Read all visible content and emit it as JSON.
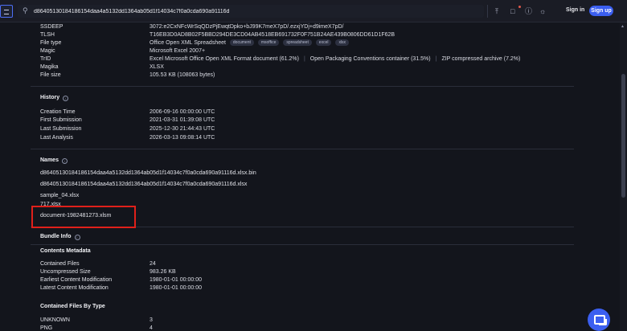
{
  "search": {
    "value": "d86405130184186154daa4a5132dd1364ab05d1f14034c7f0a0cda690a91116d"
  },
  "header": {
    "signin_label": "Sign in",
    "signup_label": "Sign up"
  },
  "basic_properties": [
    {
      "label": "SSDEEP",
      "value": "3072:e2CxNFcWrSqQDzPjEwqtDpko+bJ99K7meX7pD/.ezxjYDj+d9imeX7pD/"
    },
    {
      "label": "TLSH",
      "value": "T16EB3D0AD8B02F5BBD294DE3CD04AB4518EB691732F0F751B24AE439B0806DD61D1F62B"
    },
    {
      "label": "File type",
      "value": "Office Open XML Spreadsheet",
      "tags": [
        "document",
        "msoffice",
        "spreadsheet",
        "excel",
        "xlsx"
      ]
    },
    {
      "label": "Magic",
      "value": "Microsoft Excel 2007+"
    },
    {
      "label": "TrID",
      "parts": [
        "Excel Microsoft Office Open XML Format document (61.2%)",
        "Open Packaging Conventions container (31.5%)",
        "ZIP compressed archive (7.2%)"
      ]
    },
    {
      "label": "Magika",
      "value": "XLSX"
    },
    {
      "label": "File size",
      "value": "105.53 KB (108063 bytes)"
    }
  ],
  "history": {
    "title": "History",
    "rows": [
      {
        "label": "Creation Time",
        "value": "2006-09-16 00:00:00 UTC"
      },
      {
        "label": "First Submission",
        "value": "2021-03-31 01:39:08 UTC"
      },
      {
        "label": "Last Submission",
        "value": "2025-12-30 21:44:43 UTC"
      },
      {
        "label": "Last Analysis",
        "value": "2026-03-13 09:08:14 UTC"
      }
    ]
  },
  "names": {
    "title": "Names",
    "items": [
      "d86405130184186154daa4a5132dd1364ab05d1f14034c7f0a0cda690a91116d.xlsx.bin",
      "d86405130184186154daa4a5132dd1364ab05d1f14034c7f0a0cda690a91116d.xlsx",
      "sample_04.xlsx",
      "717.xlsx",
      "document-1982481273.xlsm"
    ]
  },
  "bundle": {
    "title": "Bundle Info",
    "contents_metadata_title": "Contents Metadata",
    "metadata": [
      {
        "label": "Contained Files",
        "value": "24"
      },
      {
        "label": "Uncompressed Size",
        "value": "983.26 KB"
      },
      {
        "label": "Earliest Content Modification",
        "value": "1980-01-01 00:00:00"
      },
      {
        "label": "Latest Content Modification",
        "value": "1980-01-01 00:00:00"
      }
    ],
    "by_type_title": "Contained Files By Type",
    "by_type": [
      {
        "label": "UNKNOWN",
        "value": "3"
      },
      {
        "label": "PNG",
        "value": "4"
      }
    ]
  },
  "colors": {
    "accent": "#3b5ff0",
    "highlight": "#e0201a",
    "background": "#13151c"
  }
}
